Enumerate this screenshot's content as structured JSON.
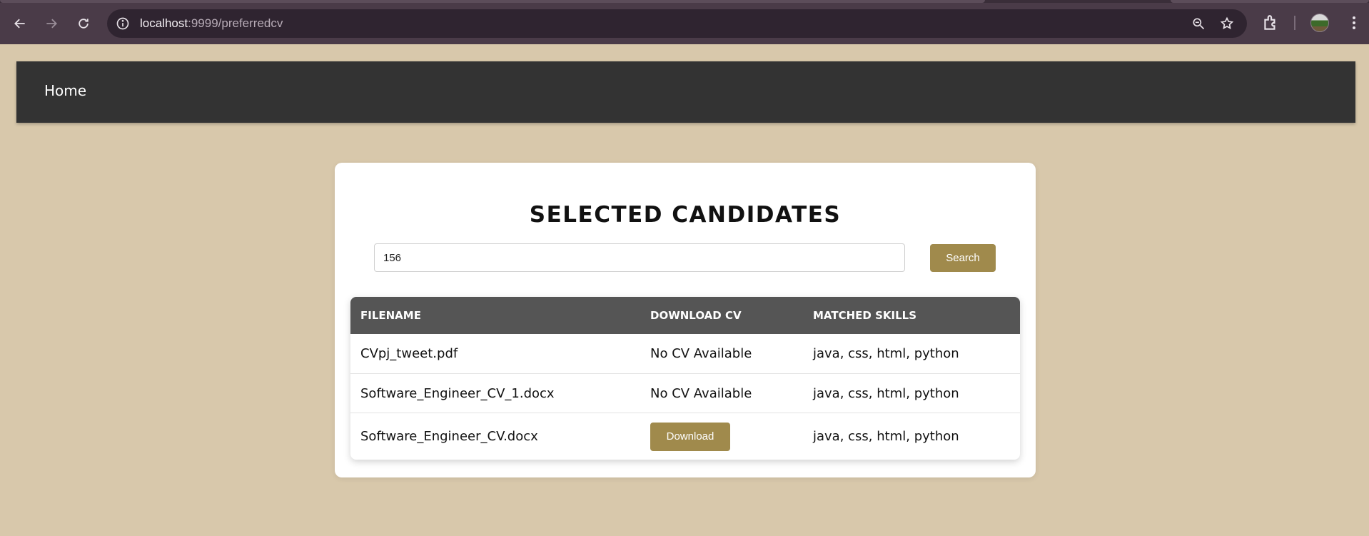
{
  "browser": {
    "url_host": "localhost",
    "url_path": ":9999/preferredcv"
  },
  "nav": {
    "home_label": "Home"
  },
  "page": {
    "title": "SELECTED CANDIDATES",
    "search": {
      "value": "156",
      "button_label": "Search"
    },
    "table": {
      "headers": [
        "FILENAME",
        "DOWNLOAD CV",
        "MATCHED SKILLS"
      ],
      "rows": [
        {
          "filename": "CVpj_tweet.pdf",
          "download": "No CV Available",
          "skills": "java, css, html, python"
        },
        {
          "filename": "Software_Engineer_CV_1.docx",
          "download": "No CV Available",
          "skills": "java, css, html, python"
        },
        {
          "filename": "Software_Engineer_CV.docx",
          "download": "Download",
          "skills": "java, css, html, python"
        }
      ]
    }
  },
  "colors": {
    "accent": "#a08a4c",
    "nav_bg": "#333333",
    "page_bg": "#d8c8ab",
    "table_header_bg": "#555555"
  }
}
